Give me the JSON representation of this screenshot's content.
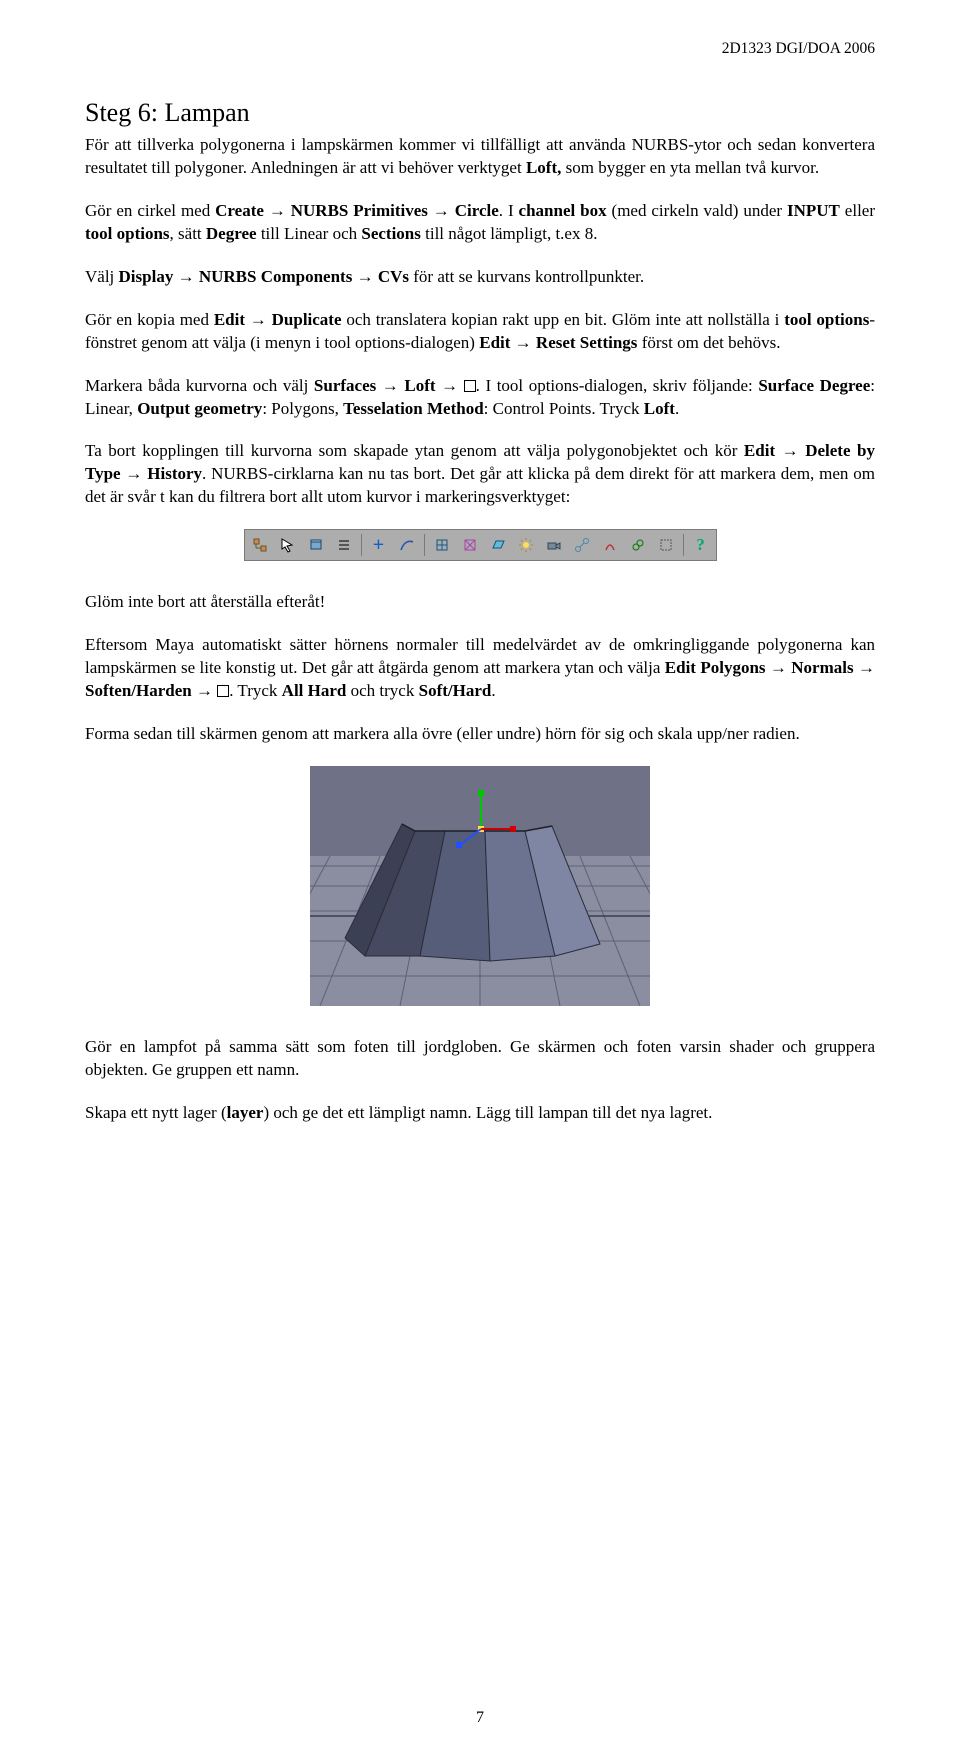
{
  "page": {
    "header_right": "2D1323 DGI/DOA 2006",
    "title": "Steg 6: Lampan",
    "p1_a": "För att tillverka polygonerna i lampskärmen kommer vi tillfälligt att använda NURBS-ytor och sedan konvertera resultatet till polygoner. Anledningen är att vi behöver verktyget ",
    "p1_loft": "Loft,",
    "p1_b": " som bygger en yta mellan två kurvor.",
    "p2_a": "Gör en cirkel med ",
    "p2_create": "Create → NURBS Primitives → Circle",
    "p2_b": ". I ",
    "p2_channel": "channel box",
    "p2_c": " (med cirkeln vald) under ",
    "p2_input": "INPUT",
    "p2_d": " eller ",
    "p2_tool": "tool options",
    "p2_e": ", sätt ",
    "p2_degree": "Degree",
    "p2_f": " till Linear och ",
    "p2_sections": "Sections",
    "p2_g": " till något lämpligt, t.ex 8.",
    "p3_a": "Välj ",
    "p3_disp": "Display → NURBS Components → CVs",
    "p3_b": " för att se kurvans kontrollpunkter.",
    "p4_a": "Gör en kopia med ",
    "p4_edit": "Edit → Duplicate",
    "p4_b": " och translatera kopian rakt upp en bit. Glöm inte att nollställa i ",
    "p4_tool": "tool options",
    "p4_c": "-fönstret genom att välja (i menyn i tool options-dialogen) ",
    "p4_reset": "Edit → Reset Settings",
    "p4_d": " först om det behövs.",
    "p5_a": "Markera båda kurvorna och välj ",
    "p5_loft": "Surfaces → Loft → ",
    "p5_b": ". I tool options-dialogen, skriv följande: ",
    "p5_sd": "Surface Degree",
    "p5_c": ": Linear, ",
    "p5_og": "Output geometry",
    "p5_d": ": Polygons, ",
    "p5_tm": "Tesselation Method",
    "p5_e": ": Control Points. Tryck ",
    "p5_loft2": "Loft",
    "p5_f": ".",
    "p6_a": "Ta bort kopplingen till kurvorna som skapade ytan genom att välja polygonobjektet och kör ",
    "p6_del": "Edit → Delete by Type → History",
    "p6_b": ". NURBS-cirklarna kan nu tas bort. Det går att klicka på dem direkt för att markera dem, men om det är svår t kan du filtrera bort allt utom kurvor i markeringsverktyget:",
    "p7": "Glöm inte bort att återställa efteråt!",
    "p8_a": "Eftersom Maya automatiskt sätter hörnens normaler till medelvärdet av de omkringliggande polygonerna kan lampskärmen se lite konstig ut. Det går att åtgärda genom att markera ytan och välja ",
    "p8_normals": "Edit Polygons → Normals → Soften/Harden → ",
    "p8_b": ". Tryck ",
    "p8_allhard": "All Hard",
    "p8_c": " och tryck ",
    "p8_softhard": "Soft/Hard",
    "p8_d": ".",
    "p9": "Forma sedan till skärmen genom att markera alla övre (eller undre) hörn för sig och skala upp/ner radien.",
    "p10": "Gör en lampfot på samma sätt som foten till jordgloben. Ge skärmen och foten varsin shader och gruppera objekten. Ge gruppen ett namn.",
    "p11_a": "Skapa ett nytt lager (",
    "p11_layer": "layer",
    "p11_b": ") och ge det ett lämpligt namn. Lägg till lampan till det nya lagret.",
    "page_num": "7"
  },
  "toolbar": {
    "icons": [
      "tree",
      "arrow",
      "box",
      "lines",
      "plus",
      "curve",
      "poly",
      "subd",
      "patch",
      "light",
      "camera",
      "bone",
      "lock",
      "ik",
      "sel",
      "help"
    ]
  }
}
